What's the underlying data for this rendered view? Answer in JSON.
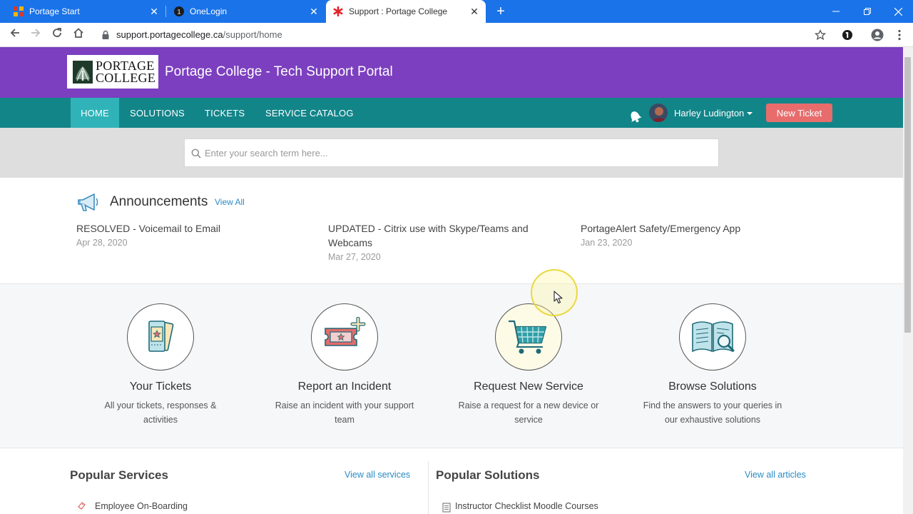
{
  "browser": {
    "tabs": [
      {
        "title": "Portage Start"
      },
      {
        "title": "OneLogin"
      },
      {
        "title": "Support : Portage College"
      }
    ],
    "url_host": "support.portagecollege.ca",
    "url_path": "/support/home",
    "new_tab_symbol": "+",
    "colors": {
      "tabbar": "#1a73e8"
    }
  },
  "header": {
    "logo_line1": "PORTAGE",
    "logo_line2": "COLLEGE",
    "portal_title": "Portage College - Tech Support Portal",
    "color": "#7b3fbf"
  },
  "nav": {
    "items": [
      "HOME",
      "SOLUTIONS",
      "TICKETS",
      "SERVICE CATALOG"
    ],
    "active": "HOME",
    "user_name": "Harley Ludington",
    "new_ticket_label": "New Ticket",
    "color": "#128589"
  },
  "search": {
    "placeholder": "Enter your search term here..."
  },
  "announcements": {
    "title": "Announcements",
    "view_all": "View All",
    "items": [
      {
        "title": "RESOLVED - Voicemail to Email",
        "date": "Apr 28, 2020"
      },
      {
        "title": "UPDATED - Citrix use with Skype/Teams and Webcams",
        "date": "Mar 27, 2020"
      },
      {
        "title": "PortageAlert Safety/Emergency App",
        "date": "Jan 23, 2020"
      }
    ]
  },
  "cards": [
    {
      "title": "Your Tickets",
      "desc": "All your tickets, responses & activities",
      "icon": "tickets-icon"
    },
    {
      "title": "Report an Incident",
      "desc": "Raise an incident with your support team",
      "icon": "incident-ticket-icon"
    },
    {
      "title": "Request New Service",
      "desc": "Raise a request for a new device or service",
      "icon": "shopping-cart-icon"
    },
    {
      "title": "Browse Solutions",
      "desc": "Find the answers to your queries in our exhaustive solutions",
      "icon": "book-search-icon"
    }
  ],
  "popular_services": {
    "title": "Popular Services",
    "view_all": "View all services",
    "items": [
      "Employee On-Boarding"
    ]
  },
  "popular_solutions": {
    "title": "Popular Solutions",
    "view_all": "View all articles",
    "items": [
      "Instructor Checklist Moodle Courses"
    ]
  }
}
